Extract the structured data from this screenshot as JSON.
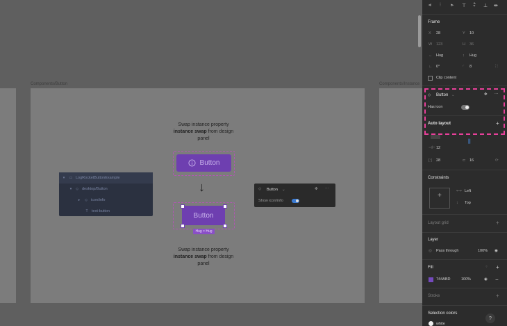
{
  "canvas": {
    "frame_left_label": "Components/Button",
    "frame_right_label": "Components/Instance",
    "layers": [
      {
        "name": "LogRocketButtonExample",
        "icon": "frame-icon"
      },
      {
        "name": "desktop/Button",
        "icon": "instance-icon"
      },
      {
        "name": "icon/info",
        "icon": "instance-icon"
      },
      {
        "name": "text-button",
        "icon": "text-icon"
      }
    ],
    "desc_top": {
      "pre": "Swap instance property",
      "bold": "instance swap",
      "post": "from design panel"
    },
    "desc_bottom": {
      "pre": "Swap instance property",
      "bold": "instance swap",
      "post": "from design panel"
    },
    "button_big_label": "Button",
    "button_small_label": "Button",
    "hug_label": "Hug × Hug",
    "popup": {
      "title": "Button",
      "prop_label": "Show icon/info"
    }
  },
  "panel": {
    "frame_title": "Frame",
    "x_label": "X",
    "x_value": "28",
    "y_label": "Y",
    "y_value": "10",
    "w_label": "W",
    "w_value": "123",
    "h_label": "H",
    "h_value": "36",
    "hug_w": "Hug",
    "hug_h": "Hug",
    "rotation": "0°",
    "radius": "8",
    "clip_content": "Clip content",
    "component_name": "Button",
    "has_icon_label": "Has icon",
    "auto_layout_title": "Auto layout",
    "gap_value": "12",
    "padding_h": "28",
    "padding_v": "16",
    "constraints_title": "Constraints",
    "constraint_h": "Left",
    "constraint_v": "Top",
    "layout_grid_title": "Layout grid",
    "layer_title": "Layer",
    "blend_mode": "Pass through",
    "layer_opacity": "100%",
    "fill_title": "Fill",
    "fill_hex": "744ABD",
    "fill_opacity": "100%",
    "stroke_title": "Stroke",
    "selection_colors_title": "Selection colors",
    "selection_color_name": "white",
    "help_label": "?"
  },
  "colors": {
    "accent": "#6e3fb0",
    "fill_swatch": "#744ABD",
    "highlight": "#e8409a",
    "toggle_on": "#3b7bd3"
  }
}
